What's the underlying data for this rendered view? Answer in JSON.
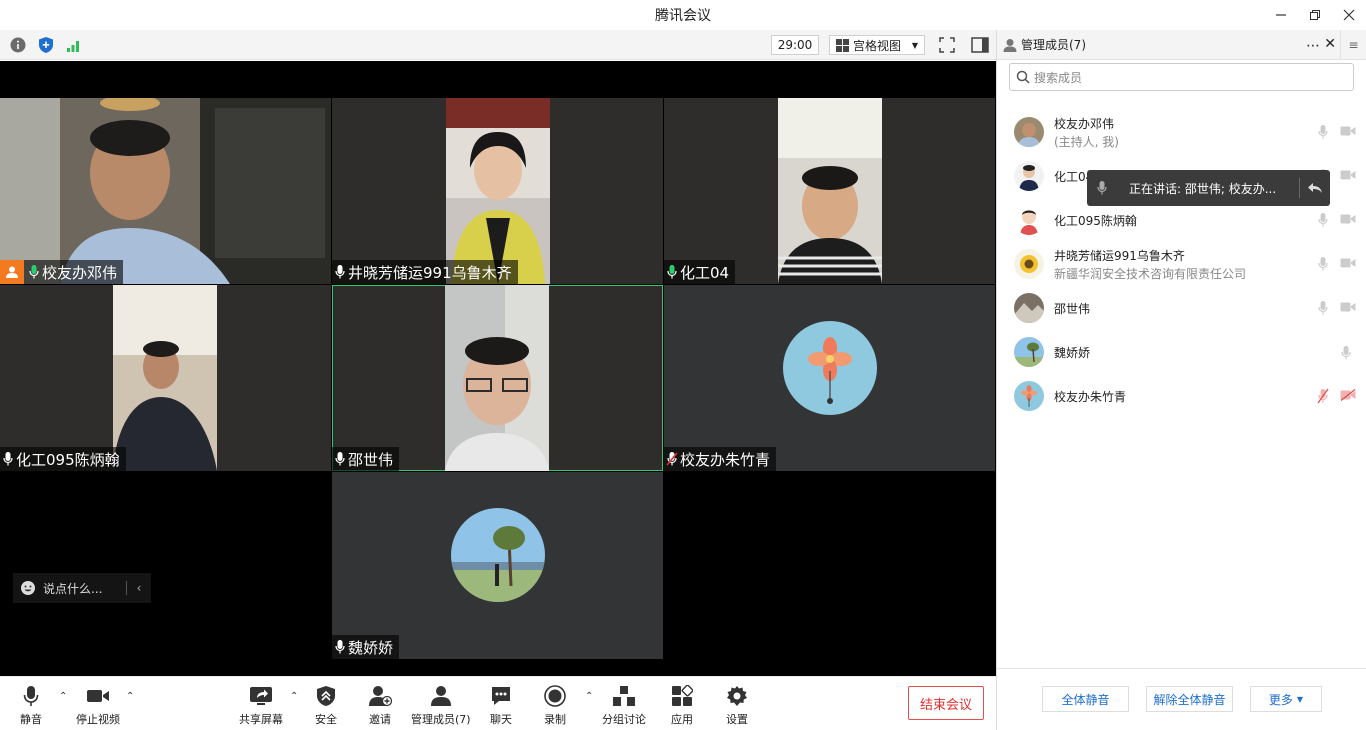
{
  "window": {
    "title": "腾讯会议"
  },
  "toolbar": {
    "timer": "29:00",
    "view_label": "宫格视图"
  },
  "tiles": [
    {
      "name": "校友办邓伟"
    },
    {
      "name": "井晓芳储运991乌鲁木齐"
    },
    {
      "name": "化工04"
    },
    {
      "name": "化工095陈炳翰"
    },
    {
      "name": "邵世伟"
    },
    {
      "name": "校友办朱竹青"
    },
    {
      "name": "魏娇娇"
    }
  ],
  "chat": {
    "placeholder": "说点什么..."
  },
  "bottombar": {
    "mute": "静音",
    "stop_video": "停止视频",
    "share": "共享屏幕",
    "security": "安全",
    "invite": "邀请",
    "members": "管理成员(7)",
    "chat": "聊天",
    "record": "录制",
    "breakout": "分组讨论",
    "apps": "应用",
    "settings": "设置",
    "end": "结束会议"
  },
  "panel": {
    "title": "管理成员(7)",
    "search_placeholder": "搜索成员",
    "members": [
      {
        "name": "校友办邓伟",
        "sub": "(主持人, 我)"
      },
      {
        "name": "化工04"
      },
      {
        "name": "化工095陈炳翰"
      },
      {
        "name": "井晓芳储运991乌鲁木齐",
        "sub": "新疆华润安全技术咨询有限责任公司"
      },
      {
        "name": "邵世伟"
      },
      {
        "name": "魏娇娇"
      },
      {
        "name": "校友办朱竹青"
      }
    ],
    "speaking": "正在讲话: 邵世伟; 校友办...",
    "mute_all": "全体静音",
    "unmute_all": "解除全体静音",
    "more": "更多"
  },
  "colors": {
    "accent": "#1f6fd0",
    "danger": "#e03030",
    "active_border": "#2ecc71",
    "host_badge": "#f47a20"
  }
}
